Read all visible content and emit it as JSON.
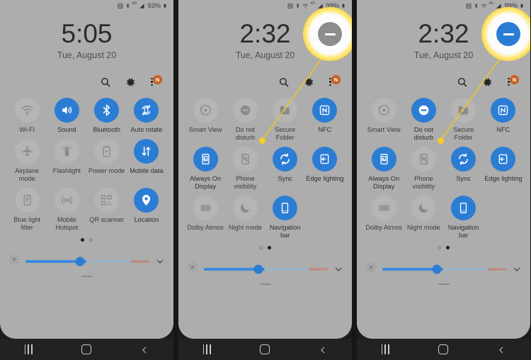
{
  "meta": {
    "accent_blue": "#2b7dd4",
    "panel_bg": "#adadad",
    "callout_yellow": "#f7cd27",
    "navbar_bg": "#222222",
    "badge_orange": "#c9601d"
  },
  "panels": [
    {
      "id": "panel-1",
      "status": {
        "battery": "93%",
        "network": "4G"
      },
      "clock": {
        "time": "5:05",
        "date": "Tue, August 20"
      },
      "header_icons": {
        "search": "search-icon",
        "settings": "gear-icon",
        "menu": "kebab-menu-icon",
        "badge": "N"
      },
      "page_dots": {
        "count": 2,
        "active": 0
      },
      "tiles": [
        [
          {
            "label": "Wi-Fi",
            "icon": "wifi-icon",
            "on": false
          },
          {
            "label": "Sound",
            "icon": "sound-icon",
            "on": true
          },
          {
            "label": "Bluetooth",
            "icon": "bluetooth-icon",
            "on": true
          },
          {
            "label": "Auto rotate",
            "icon": "auto-rotate-icon",
            "on": true
          }
        ],
        [
          {
            "label": "Airplane mode",
            "icon": "airplane-icon",
            "on": false
          },
          {
            "label": "Flashlight",
            "icon": "flashlight-icon",
            "on": false
          },
          {
            "label": "Power mode",
            "icon": "power-mode-icon",
            "on": false
          },
          {
            "label": "Mobile data",
            "icon": "mobile-data-icon",
            "on": true
          }
        ],
        [
          {
            "label": "Blue light filter",
            "icon": "blue-light-filter-icon",
            "on": false
          },
          {
            "label": "Mobile Hotspot",
            "icon": "hotspot-icon",
            "on": false
          },
          {
            "label": "QR scanner",
            "icon": "qr-scanner-icon",
            "on": false
          },
          {
            "label": "Location",
            "icon": "location-icon",
            "on": true
          }
        ]
      ],
      "brightness": {
        "icon": "brightness-icon",
        "value": 44,
        "expand": "chevron-down-icon"
      },
      "navbar": {
        "recents": "recents-icon",
        "home": "home-icon",
        "back": "back-icon"
      },
      "callout": null
    },
    {
      "id": "panel-2",
      "status": {
        "battery": "99%",
        "network": "4G"
      },
      "clock": {
        "time": "2:32",
        "date": "Tue, August 20"
      },
      "header_icons": {
        "search": "search-icon",
        "settings": "gear-icon",
        "menu": "kebab-menu-icon",
        "badge": "N"
      },
      "page_dots": {
        "count": 2,
        "active": 1
      },
      "tiles": [
        [
          {
            "label": "Smart View",
            "icon": "smart-view-icon",
            "on": false
          },
          {
            "label": "Do not disturb",
            "icon": "do-not-disturb-icon",
            "on": false
          },
          {
            "label": "Secure Folder",
            "icon": "secure-folder-icon",
            "on": false
          },
          {
            "label": "NFC",
            "icon": "nfc-icon",
            "on": true
          }
        ],
        [
          {
            "label": "Always On Display",
            "icon": "always-on-display-icon",
            "on": true
          },
          {
            "label": "Phone visibility",
            "icon": "phone-visibility-icon",
            "on": false
          },
          {
            "label": "Sync",
            "icon": "sync-icon",
            "on": true
          },
          {
            "label": "Edge lighting",
            "icon": "edge-lighting-icon",
            "on": true
          }
        ],
        [
          {
            "label": "Dolby Atmos",
            "icon": "dolby-atmos-icon",
            "on": false
          },
          {
            "label": "Night mode",
            "icon": "night-mode-icon",
            "on": false
          },
          {
            "label": "Navigation bar",
            "icon": "navigation-bar-icon",
            "on": true
          }
        ]
      ],
      "brightness": {
        "icon": "brightness-icon",
        "value": 44,
        "expand": "chevron-down-icon"
      },
      "navbar": {
        "recents": "recents-icon",
        "home": "home-icon",
        "back": "back-icon"
      },
      "callout": {
        "icon": "do-not-disturb-icon",
        "state": "off"
      }
    },
    {
      "id": "panel-3",
      "status": {
        "battery": "99%",
        "network": "4G"
      },
      "clock": {
        "time": "2:32",
        "date": "Tue, August 20"
      },
      "header_icons": {
        "search": "search-icon",
        "settings": "gear-icon",
        "menu": "kebab-menu-icon",
        "badge": "N"
      },
      "page_dots": {
        "count": 2,
        "active": 1
      },
      "tiles": [
        [
          {
            "label": "Smart View",
            "icon": "smart-view-icon",
            "on": false
          },
          {
            "label": "Do not disturb",
            "icon": "do-not-disturb-icon",
            "on": true
          },
          {
            "label": "Secure Folder",
            "icon": "secure-folder-icon",
            "on": false
          },
          {
            "label": "NFC",
            "icon": "nfc-icon",
            "on": true
          }
        ],
        [
          {
            "label": "Always On Display",
            "icon": "always-on-display-icon",
            "on": true
          },
          {
            "label": "Phone visibility",
            "icon": "phone-visibility-icon",
            "on": false
          },
          {
            "label": "Sync",
            "icon": "sync-icon",
            "on": true
          },
          {
            "label": "Edge lighting",
            "icon": "edge-lighting-icon",
            "on": true
          }
        ],
        [
          {
            "label": "Dolby Atmos",
            "icon": "dolby-atmos-icon",
            "on": false
          },
          {
            "label": "Night mode",
            "icon": "night-mode-icon",
            "on": false
          },
          {
            "label": "Navigation bar",
            "icon": "navigation-bar-icon",
            "on": true
          }
        ]
      ],
      "brightness": {
        "icon": "brightness-icon",
        "value": 44,
        "expand": "chevron-down-icon"
      },
      "navbar": {
        "recents": "recents-icon",
        "home": "home-icon",
        "back": "back-icon"
      },
      "callout": {
        "icon": "do-not-disturb-icon",
        "state": "on"
      }
    }
  ]
}
